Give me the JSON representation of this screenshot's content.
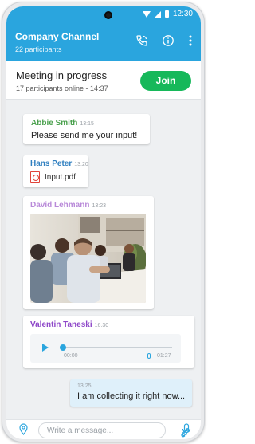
{
  "status_bar": {
    "time": "12:30"
  },
  "header": {
    "title": "Company Channel",
    "subtitle": "22 participants",
    "icons": [
      "call-icon",
      "info-icon",
      "more-vert-icon"
    ]
  },
  "meeting": {
    "title": "Meeting in progress",
    "subtitle": "17 participants online - 14:37",
    "join_label": "Join"
  },
  "messages": [
    {
      "sender": "Abbie Smith",
      "time": "13:15",
      "text": "Please send me your input!"
    },
    {
      "sender": "Hans Peter",
      "time": "13:20",
      "file_name": "Input.pdf"
    },
    {
      "sender": "David Lehmann",
      "time": "13:23"
    },
    {
      "sender": "Valentin Taneski",
      "time": "16:30",
      "audio_start": "00:00",
      "audio_end": "01:27",
      "progress": 0
    },
    {
      "time": "13:25",
      "text": "I am collecting it right now..."
    }
  ],
  "composer": {
    "placeholder": "Write a message..."
  },
  "colors": {
    "brand": "#2aa5de",
    "join": "#16b85a",
    "sender_abbie": "#4ba14e",
    "sender_hans": "#2f7fc0",
    "sender_david": "#b98ad9",
    "sender_valentin": "#8d46c8",
    "own_bubble": "#dff0fa"
  }
}
